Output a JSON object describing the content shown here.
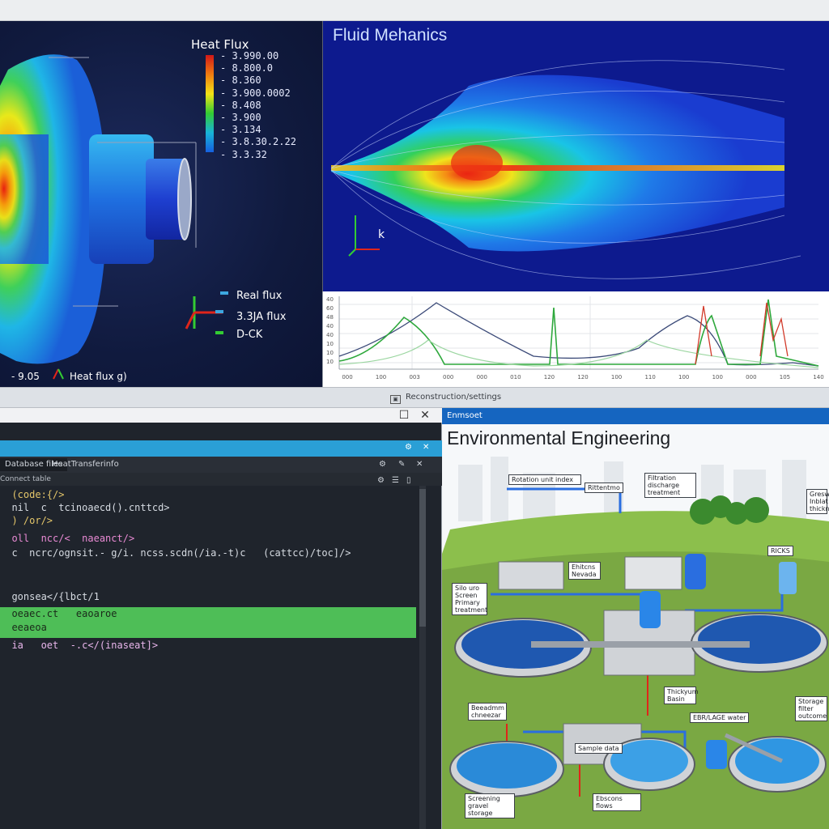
{
  "heat": {
    "colorbar_title": "Heat Flux",
    "colorbar_labels": [
      "- 3.990.00",
      "- 8.800.0",
      "- 8.360",
      "- 3.900.0002",
      "- 8.408",
      "- 3.900",
      "- 3.134",
      "- 3.8.30.2.22",
      "- 3.3.32"
    ],
    "legend": [
      "Real flux",
      "3.3JA flux",
      "D-CK"
    ],
    "bottom_left": "- 9.05",
    "bottom_right": "Heat flux g)"
  },
  "fluid": {
    "title": "Fluid Mehanics",
    "axis_label": "k"
  },
  "linechart": {
    "y_ticks": [
      "40",
      "60",
      "48",
      "40",
      "40",
      "10",
      "10",
      "10"
    ],
    "x_ticks": [
      "000",
      "100",
      "003",
      "000",
      "000",
      "010",
      "120",
      "120",
      "100",
      "110",
      "100",
      "100",
      "000",
      "105",
      "140"
    ]
  },
  "midbar": {
    "text": "Reconstruction/settings",
    "icon": "window-icon"
  },
  "editor": {
    "tab1": "Database files",
    "tab2": "HeatTransferinfo",
    "sub": "Connect table",
    "code": [
      "  (code:{/>",
      "  nil  c  tcinoaecd().cnttcd>",
      "  ) /or/>",
      "",
      "  oll  ncc/<  naeanct/>",
      "  c  ncrc/ognsit.- g/i. ncss.scdn(/ia.-t)c   (cattcc)/toc]/>",
      "",
      "",
      "  gonsea</{lbct/1",
      "  oeaec.ct   eaoaroe",
      "  eeaeoa",
      "  ia   oet  -.c</(inaseat]>"
    ]
  },
  "env": {
    "bar_label": "Enmsoet",
    "title": "Environmental Engineering",
    "callouts": [
      "Rotation unit index",
      "Rittentmo",
      "Filtration discharge treatment",
      "Ehitcns Nevada",
      "Silo uro Screen Primary treatment",
      "RICKS",
      "Gresw Inblat thickn",
      "Thickyum Basin",
      "Beeadmm chneezar",
      "EBR/LAGE water",
      "Storage filter outcome",
      "Sample data",
      "Screening gravel storage",
      "Ebscons flows"
    ]
  },
  "colors": {
    "fluid_bg": "#0d1a8e",
    "heat_bg": "#101a3e",
    "editor_bg": "#1f242c",
    "accent_blue": "#2a9fd6",
    "highlight_green": "#4ebe57",
    "env_bar": "#1565c0"
  }
}
